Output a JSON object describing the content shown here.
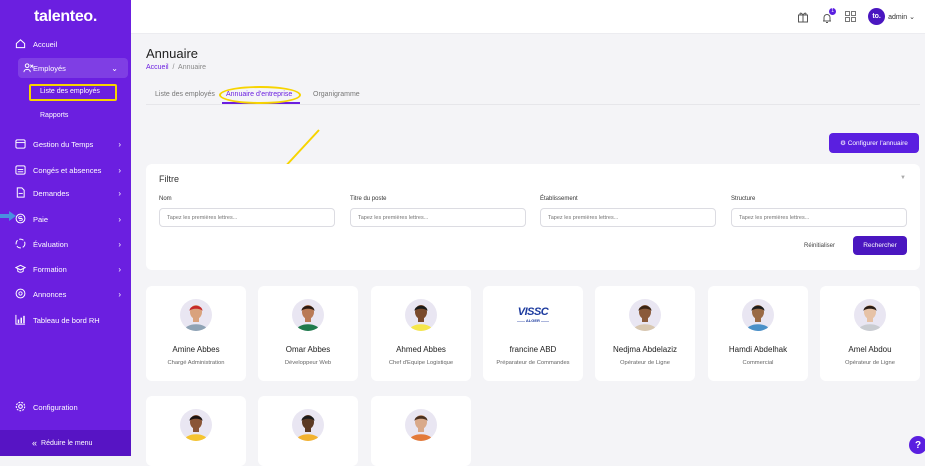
{
  "brand": "talenteo.",
  "sidebar": {
    "items": [
      {
        "label": "Accueil",
        "icon": "home-icon",
        "chevron": ""
      },
      {
        "label": "Employés",
        "icon": "users-icon",
        "chevron": "⌄"
      },
      {
        "label": "Gestion du Temps",
        "icon": "calendar-icon",
        "chevron": "›"
      },
      {
        "label": "Congés et absences",
        "icon": "leave-icon",
        "chevron": "›"
      },
      {
        "label": "Demandes",
        "icon": "document-icon",
        "chevron": "›"
      },
      {
        "label": "Paie",
        "icon": "money-icon",
        "chevron": "›"
      },
      {
        "label": "Évaluation",
        "icon": "evaluation-icon",
        "chevron": "›"
      },
      {
        "label": "Formation",
        "icon": "graduation-icon",
        "chevron": "›"
      },
      {
        "label": "Annonces",
        "icon": "announce-icon",
        "chevron": "›"
      },
      {
        "label": "Tableau de bord RH",
        "icon": "dashboard-icon",
        "chevron": ""
      }
    ],
    "subitems": [
      "Liste des employés",
      "Rapports"
    ],
    "config": "Configuration",
    "collapse": "Réduire le menu",
    "collapse_icon": "«"
  },
  "topbar": {
    "notification_count": "1",
    "avatar_text": "to.",
    "user": "admin ⌄"
  },
  "page": {
    "title": "Annuaire",
    "breadcrumb_home": "Accueil",
    "breadcrumb_sep": "/",
    "breadcrumb_current": "Annuaire"
  },
  "tabs": [
    "Liste des employés",
    "Annuaire d'entreprise",
    "Organigramme"
  ],
  "config_button": "⚙ Configurer l'annuaire",
  "filter": {
    "title": "Filtre",
    "caret": "▼",
    "fields": [
      {
        "label": "Nom",
        "placeholder": "Tapez les premières lettres..."
      },
      {
        "label": "Titre du poste",
        "placeholder": "Tapez les premières lettres..."
      },
      {
        "label": "Établissement",
        "placeholder": "Tapez les premières lettres..."
      },
      {
        "label": "Structure",
        "placeholder": "Tapez les premières lettres..."
      }
    ],
    "reset": "Réinitialiser",
    "search": "Rechercher"
  },
  "employees": [
    {
      "name": "Amine Abbes",
      "role": "Chargé Administration",
      "skin": "#d9a27d",
      "hair": "#c62828",
      "shirt": "#8fa3b5"
    },
    {
      "name": "Omar Abbes",
      "role": "Développeur Web",
      "skin": "#b97a56",
      "hair": "#2b1a12",
      "shirt": "#1f7a4c"
    },
    {
      "name": "Ahmed Abbes",
      "role": "Chef d'Equipe Logistique",
      "skin": "#7a4a2c",
      "hair": "#1a1a1a",
      "shirt": "#f5e64b"
    },
    {
      "name": "francine ABD",
      "role": "Préparateur de Commandes",
      "logo": "VISSC",
      "logo_sub": "—— ALGER ——"
    },
    {
      "name": "Nedjma Abdelaziz",
      "role": "Opérateur de Ligne",
      "skin": "#8a5a3a",
      "hair": "#3a2414",
      "shirt": "#d8c7b0"
    },
    {
      "name": "Hamdi Abdelhak",
      "role": "Commercial",
      "skin": "#9a6a45",
      "hair": "#1c1c1c",
      "shirt": "#4a90c8"
    },
    {
      "name": "Amel Abdou",
      "role": "Opérateur de Ligne",
      "skin": "#e6c2a6",
      "hair": "#2a1d16",
      "shirt": "#c9ccd1"
    },
    {
      "name": "",
      "role": "",
      "skin": "#8a5536",
      "hair": "#1a1210",
      "shirt": "#f5c431"
    },
    {
      "name": "",
      "role": "",
      "skin": "#5c3a24",
      "hair": "#1a1a1a",
      "shirt": "#f2b230"
    },
    {
      "name": "",
      "role": "",
      "skin": "#d9a98a",
      "hair": "#4a3020",
      "shirt": "#e37a3a"
    }
  ],
  "help": "?",
  "colors": {
    "brand": "#6b1fe0",
    "accent": "#5a1fe0",
    "highlight": "#f7d400"
  }
}
